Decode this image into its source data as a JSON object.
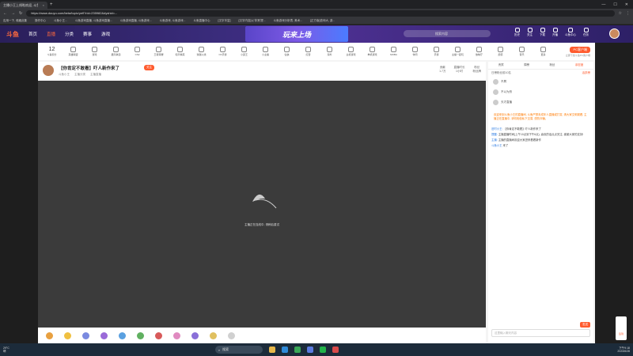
{
  "browser": {
    "tab_title": "主播小王上线啦欢迎, 斗鱼大主播直播",
    "tab_close": "×",
    "newtab": "+",
    "url": "https://www.douyu.com/beta/topic/yefl?rid=235982&dyshid=...",
    "bookmarks": [
      "应用一下, 收藏此集",
      "操作中心",
      "斗鱼小王...",
      "斗鱼游戏直播, 斗鱼游戏直播...",
      "斗鱼游戏直播, 斗鱼游戏...",
      "斗鱼游戏, 斗鱼游戏...",
      "斗鱼直播中心",
      "[汉字丰富]",
      "[汉字内容]以'非常'提...",
      "斗鱼游戏分析表, 美术...",
      "[正方版]查询大, 游..."
    ]
  },
  "site": {
    "logo": "斗鱼",
    "nav": [
      "首页",
      "直播",
      "分类",
      "赛事",
      "游戏"
    ],
    "hot_index": 1,
    "banner": "玩来上场",
    "search_placeholder": "搜索内容",
    "user_menu": [
      "历史",
      "关注",
      "下载",
      "开播",
      "斗鱼中心",
      "任务"
    ]
  },
  "categories": {
    "first_num": "12",
    "first_label": "斗鱼积分",
    "items": [
      "英雄联盟",
      "游戏",
      "星际争霸",
      "CS2",
      "王者荣耀",
      "和平精英",
      "穿越火线",
      "CF手游",
      "小霸王",
      "小主播",
      "仙侠",
      "红警",
      "海外",
      "主机游戏",
      "单机游戏",
      "MOBA",
      "休闲",
      "手游",
      "主播一起玩",
      "放映厅",
      "颜值",
      "音乐",
      "更多"
    ],
    "pc_button": "PC客户端",
    "right_small": "立即下载斗鱼PC客户端"
  },
  "room": {
    "title": "【你肯定不敢看】吓人新作来了",
    "follow_label": "关注",
    "meta": [
      "斗鱼小王",
      "主播分类",
      "主播直播"
    ],
    "stats": [
      {
        "label": "贡献",
        "value": "1.7万"
      },
      {
        "label": "直播时长",
        "value": "1小时"
      },
      {
        "label": "粉丝",
        "value": "粉丝牌"
      }
    ]
  },
  "player": {
    "status": "主播正在连线中, 请稍后重试"
  },
  "chat": {
    "tabs": [
      "贵宾",
      "周榜",
      "粉丝",
      "亲密度"
    ],
    "selected_tab": 3,
    "rank_header_left": "日榜粉丝前10名",
    "rank_header_right": "活跃榜",
    "rank_items": [
      "不屑",
      "不以为然",
      "天才直播"
    ],
    "notice": "欢迎来到斗鱼小王的直播间, 斗鱼严禁未成年人直播或打赏, 请大家文明观看, 主播正在直播中, 请勿相信私下交易, 谨防诈骗。",
    "messages": [
      {
        "name": "旧时小王:",
        "text": "【你肯定不敢看】吓人新作来了"
      },
      {
        "name": "提醒:",
        "text": "主播直播时间(上午10点到下午6点), 喜欢的话点点关注, 谢谢大家的支持!"
      },
      {
        "name": "主播:",
        "text": "主播的直播间欢迎大家进来看看新作"
      },
      {
        "name": "斗鱼小王",
        "text": "来了"
      }
    ],
    "input_placeholder": "这里输入聊天内容",
    "send_label": "发送"
  },
  "rightrail": {
    "label": "签到"
  },
  "taskbar": {
    "temp": "29°C",
    "weather": "晴",
    "search": "搜索",
    "time": "下午9:18",
    "date": "2023/6/28"
  }
}
